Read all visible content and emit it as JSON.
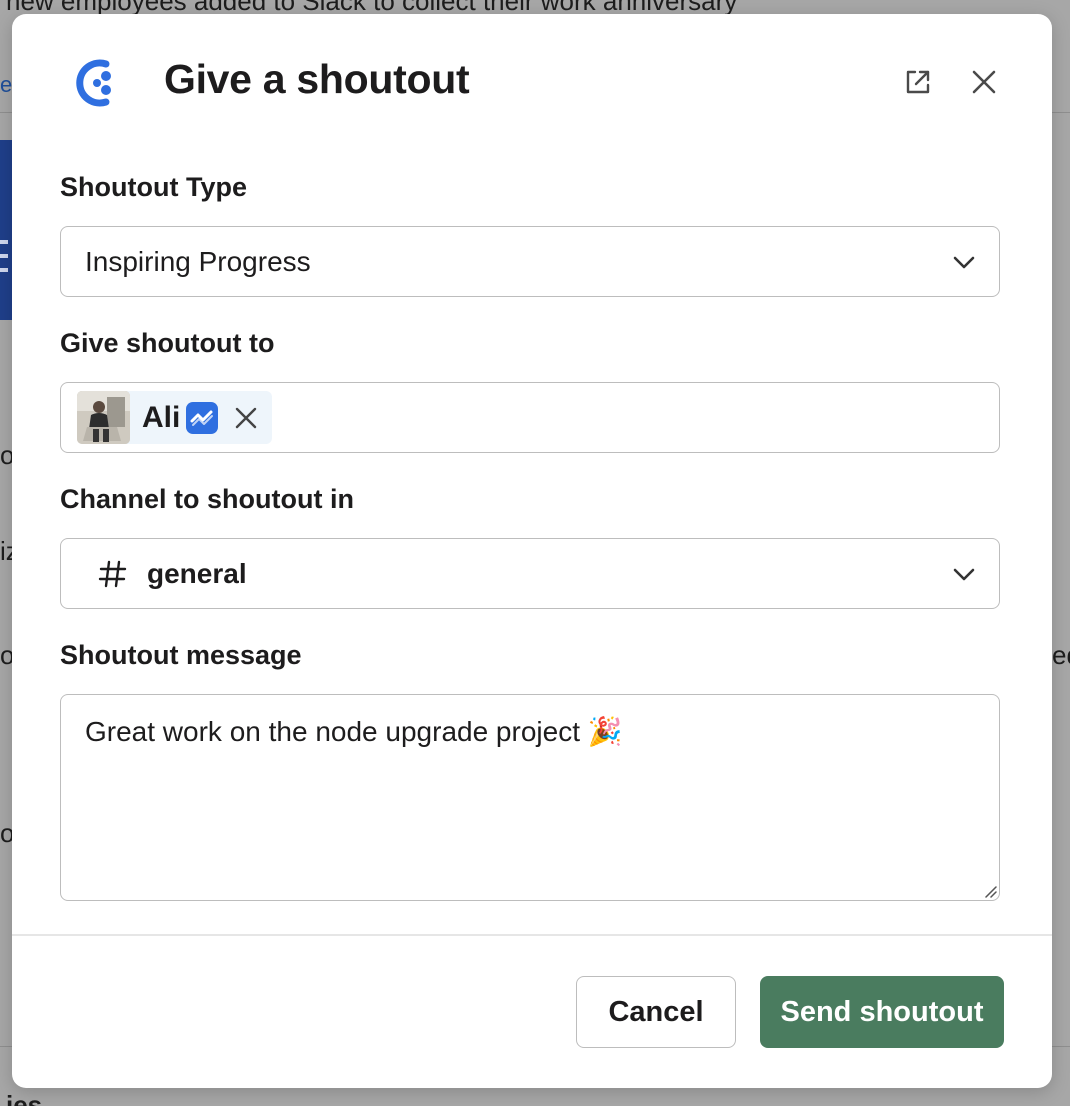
{
  "background": {
    "top_text": "new employees added to Slack to collect their work anniversary",
    "bottom_text": "ies",
    "left_fragments": [
      "e",
      "o",
      "iz",
      "o",
      "o"
    ],
    "right_fragment": "ed"
  },
  "modal": {
    "title": "Give a shoutout",
    "app_icon": "app-logo-icon",
    "external_link_icon": "external-link-icon",
    "close_icon": "close-icon"
  },
  "form": {
    "shoutout_type": {
      "label": "Shoutout Type",
      "value": "Inspiring Progress"
    },
    "recipient": {
      "label": "Give shoutout to",
      "chip_name": "Ali"
    },
    "channel": {
      "label": "Channel to shoutout in",
      "value": "general"
    },
    "message": {
      "label": "Shoutout message",
      "value": "Great work on the node upgrade project 🎉"
    }
  },
  "footer": {
    "cancel_label": "Cancel",
    "send_label": "Send shoutout"
  },
  "colors": {
    "send_button": "#4a7c5f",
    "chip_background": "#eef5fb",
    "badge": "#2f6fe0",
    "logo": "#2f6fe0"
  }
}
